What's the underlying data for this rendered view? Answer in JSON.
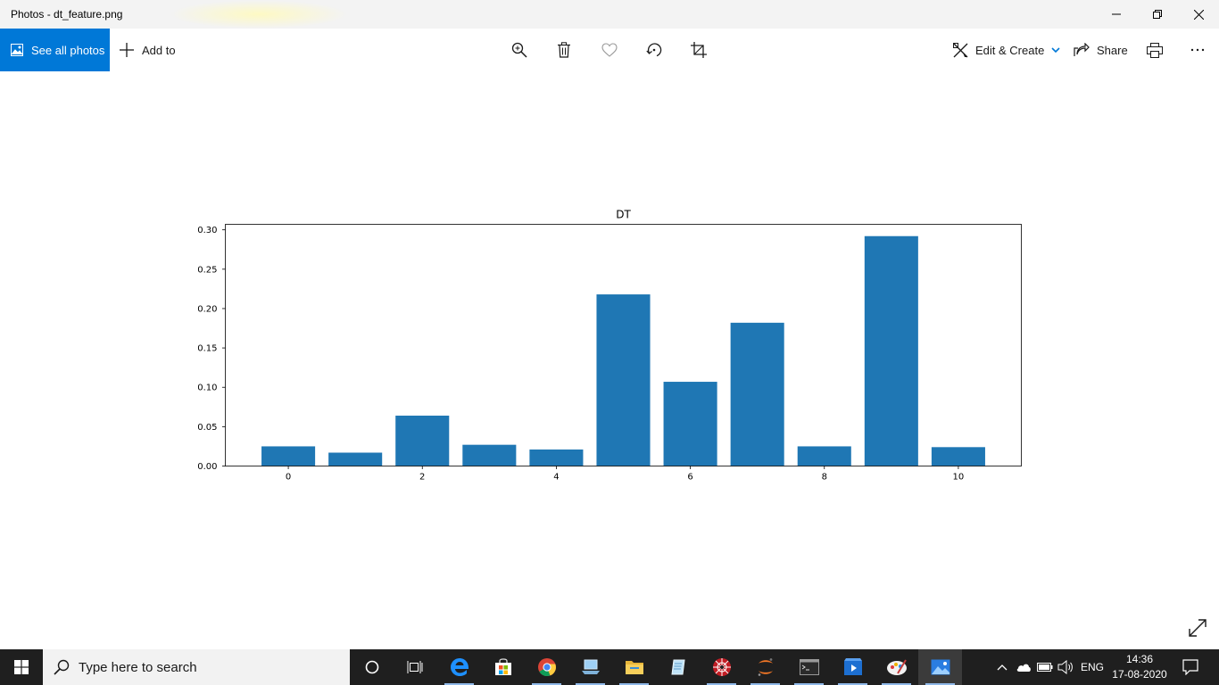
{
  "window": {
    "title": "Photos - dt_feature.png",
    "controls": [
      "minimize-icon",
      "restore-icon",
      "close-icon"
    ]
  },
  "toolbar": {
    "see_all_label": "See all photos",
    "add_to_label": "Add to",
    "icons": [
      "zoom-icon",
      "delete-icon",
      "favorite-icon",
      "rotate-icon",
      "crop-icon"
    ],
    "edit_create_label": "Edit & Create",
    "share_label": "Share",
    "accent_color": "#0078d7"
  },
  "chart_data": {
    "type": "bar",
    "title": "DT",
    "xlabel": "",
    "ylabel": "",
    "x": [
      0,
      1,
      2,
      3,
      4,
      5,
      6,
      7,
      8,
      9,
      10
    ],
    "values": [
      0.025,
      0.017,
      0.064,
      0.027,
      0.021,
      0.218,
      0.107,
      0.182,
      0.025,
      0.292,
      0.024
    ],
    "xticks": [
      "0",
      "2",
      "4",
      "6",
      "8",
      "10"
    ],
    "yticks": [
      "0.00",
      "0.05",
      "0.10",
      "0.15",
      "0.20",
      "0.25",
      "0.30"
    ],
    "ylim": [
      0,
      0.307
    ],
    "xlim": [
      -0.94,
      10.94
    ],
    "bar_color": "#1f77b4",
    "grid": false
  },
  "taskbar": {
    "search_placeholder": "Type here to search",
    "apps": [
      "cortana-icon",
      "task-view-icon",
      "edge-icon",
      "store-icon",
      "chrome-icon",
      "laptop-app-icon",
      "file-explorer-icon",
      "notepad-app-icon",
      "spider-app-icon",
      "jupyter-icon",
      "terminal-icon",
      "video-editor-icon",
      "paint-app-icon",
      "photos-icon"
    ],
    "language": "ENG",
    "time": "14:36",
    "date": "17-08-2020"
  }
}
